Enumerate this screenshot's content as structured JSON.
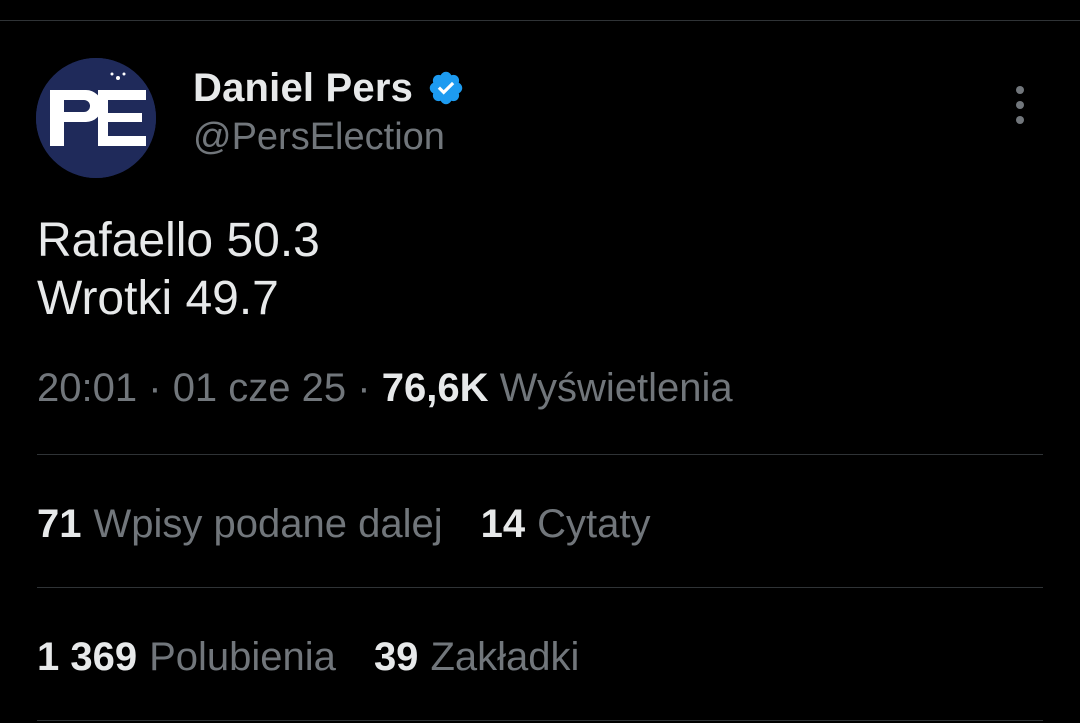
{
  "author": {
    "display_name": "Daniel Pers",
    "handle": "@PersElection",
    "verified": true,
    "avatar_text": "PE",
    "avatar_color": "#1f2a5a",
    "verified_color": "#1d9bf0"
  },
  "more_icon": "more-vertical-icon",
  "tweet": {
    "lines": [
      "Rafaello 50.3",
      "Wrotki 49.7"
    ]
  },
  "meta": {
    "time": "20:01",
    "separator": "·",
    "date": "01 cze 25",
    "views_count": "76,6K",
    "views_label": "Wyświetlenia"
  },
  "stats": {
    "retweets_count": "71",
    "retweets_label": "Wpisy podane dalej",
    "quotes_count": "14",
    "quotes_label": "Cytaty",
    "likes_count": "1 369",
    "likes_label": "Polubienia",
    "bookmarks_count": "39",
    "bookmarks_label": "Zakładki"
  },
  "colors": {
    "background": "#000000",
    "text_primary": "#e7e9ea",
    "text_secondary": "#71767b",
    "divider": "#2f3336"
  }
}
